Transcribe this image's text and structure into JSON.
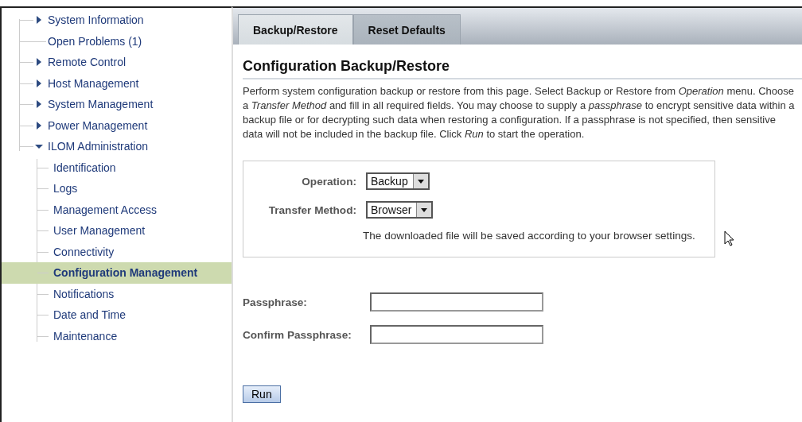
{
  "sidebar": {
    "items": [
      {
        "label": "System Information",
        "kind": "folder",
        "expanded": false,
        "selected": false
      },
      {
        "label": "Open Problems (1)",
        "kind": "leaf",
        "selected": false
      },
      {
        "label": "Remote Control",
        "kind": "folder",
        "expanded": false,
        "selected": false
      },
      {
        "label": "Host Management",
        "kind": "folder",
        "expanded": false,
        "selected": false
      },
      {
        "label": "System Management",
        "kind": "folder",
        "expanded": false,
        "selected": false
      },
      {
        "label": "Power Management",
        "kind": "folder",
        "expanded": false,
        "selected": false
      },
      {
        "label": "ILOM Administration",
        "kind": "folder",
        "expanded": true,
        "selected": false,
        "children": [
          {
            "label": "Identification",
            "kind": "leaf",
            "selected": false
          },
          {
            "label": "Logs",
            "kind": "leaf",
            "selected": false
          },
          {
            "label": "Management Access",
            "kind": "leaf",
            "selected": false
          },
          {
            "label": "User Management",
            "kind": "leaf",
            "selected": false
          },
          {
            "label": "Connectivity",
            "kind": "leaf",
            "selected": false
          },
          {
            "label": "Configuration Management",
            "kind": "leaf",
            "selected": true
          },
          {
            "label": "Notifications",
            "kind": "leaf",
            "selected": false
          },
          {
            "label": "Date and Time",
            "kind": "leaf",
            "selected": false
          },
          {
            "label": "Maintenance",
            "kind": "leaf",
            "selected": false
          }
        ]
      }
    ]
  },
  "tabs": [
    {
      "label": "Backup/Restore",
      "selected": true
    },
    {
      "label": "Reset Defaults",
      "selected": false
    }
  ],
  "heading": "Configuration Backup/Restore",
  "description": "Perform system configuration backup or restore from this page. Select Backup or Restore from *Operation* menu. Choose a *Transfer Method* and fill in all required fields. You may choose to supply a *passphrase* to encrypt sensitive data within a backup file or for decrypting such data when restoring a configuration. If a passphrase is not specified, then sensitive data will not be included in the backup file. Click *Run* to start the operation.",
  "options": {
    "operation": {
      "label": "Operation:",
      "value": "Backup"
    },
    "transfer_method": {
      "label": "Transfer Method:",
      "value": "Browser"
    },
    "note": "The downloaded file will be saved according to your browser settings."
  },
  "passphrase": {
    "label": "Passphrase:"
  },
  "confirm_passphrase": {
    "label": "Confirm Passphrase:"
  },
  "run_button": "Run"
}
